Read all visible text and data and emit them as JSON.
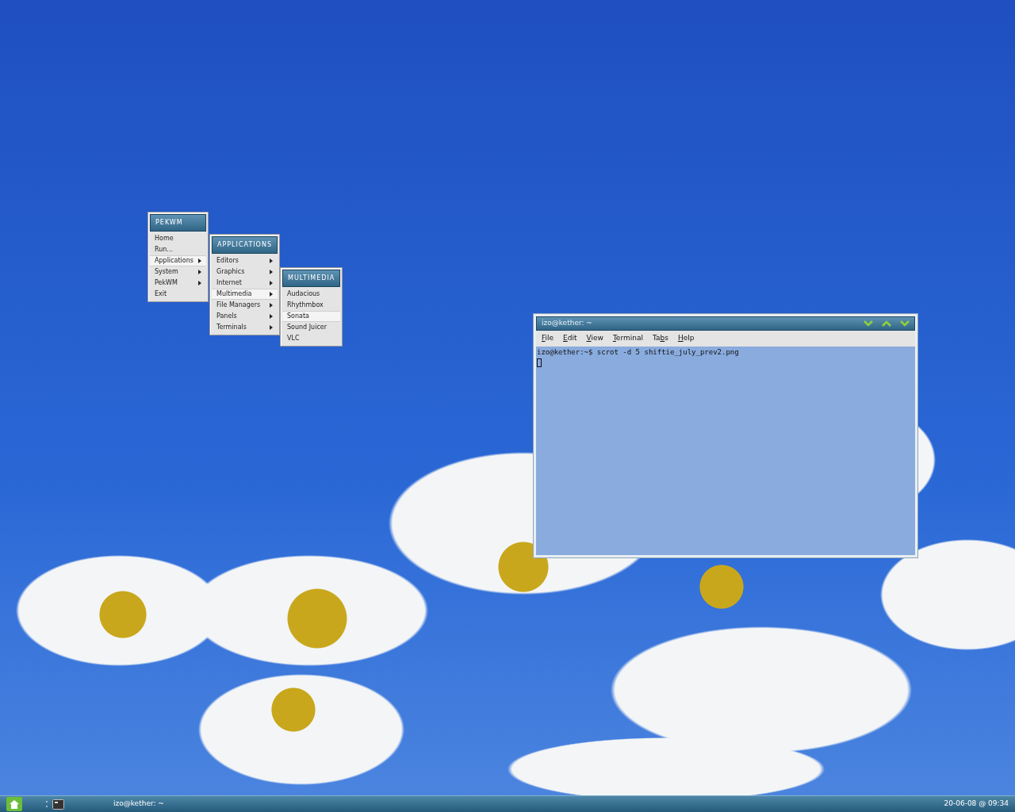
{
  "menus": [
    {
      "title": "PEKWM",
      "items": [
        {
          "label": "Home",
          "submenu": false,
          "selected": false
        },
        {
          "label": "Run...",
          "submenu": false,
          "selected": false
        },
        {
          "label": "Applications",
          "submenu": true,
          "selected": true
        },
        {
          "label": "System",
          "submenu": true,
          "selected": false
        },
        {
          "label": "PekWM",
          "submenu": true,
          "selected": false
        },
        {
          "label": "Exit",
          "submenu": false,
          "selected": false
        }
      ]
    },
    {
      "title": "APPLICATIONS",
      "items": [
        {
          "label": "Editors",
          "submenu": true,
          "selected": false
        },
        {
          "label": "Graphics",
          "submenu": true,
          "selected": false
        },
        {
          "label": "Internet",
          "submenu": true,
          "selected": false
        },
        {
          "label": "Multimedia",
          "submenu": true,
          "selected": true
        },
        {
          "label": "File Managers",
          "submenu": true,
          "selected": false
        },
        {
          "label": "Panels",
          "submenu": true,
          "selected": false
        },
        {
          "label": "Terminals",
          "submenu": true,
          "selected": false
        }
      ]
    },
    {
      "title": "MULTIMEDIA",
      "items": [
        {
          "label": "Audacious",
          "submenu": false,
          "selected": false
        },
        {
          "label": "Rhythmbox",
          "submenu": false,
          "selected": false
        },
        {
          "label": "Sonata",
          "submenu": false,
          "selected": true
        },
        {
          "label": "Sound Juicer",
          "submenu": false,
          "selected": false
        },
        {
          "label": "VLC",
          "submenu": false,
          "selected": false
        }
      ]
    }
  ],
  "terminal": {
    "title": "izo@kether: ~",
    "menubar": [
      {
        "key": "F",
        "after": "ile"
      },
      {
        "key": "E",
        "after": "dit"
      },
      {
        "key": "V",
        "after": "iew"
      },
      {
        "key": "T",
        "after": "erminal"
      },
      {
        "before": "Ta",
        "key": "b",
        "after": "s"
      },
      {
        "key": "H",
        "after": "elp"
      }
    ],
    "lines": [
      "izo@kether:~$ scrot -d 5 shiftie_july_prev2.png"
    ]
  },
  "taskbar": {
    "task": "izo@kether: ~",
    "clock": "20-06-08 @ 09:34"
  }
}
